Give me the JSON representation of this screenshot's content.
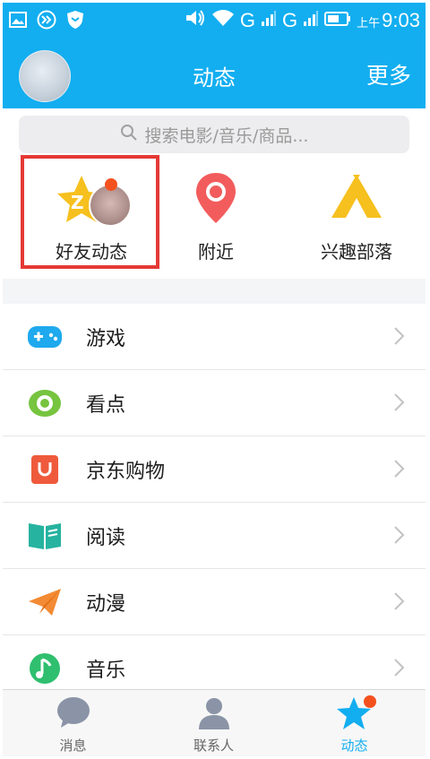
{
  "status_bar": {
    "network_1": "G",
    "network_2": "G",
    "ampm": "上午",
    "time": "9:03"
  },
  "header": {
    "title": "动态",
    "more_label": "更多"
  },
  "search": {
    "placeholder": "搜索电影/音乐/商品..."
  },
  "quick_actions": [
    {
      "label": "好友动态",
      "icon": "friend-feed-star-icon",
      "has_badge": true
    },
    {
      "label": "附近",
      "icon": "location-pin-icon"
    },
    {
      "label": "兴趣部落",
      "icon": "tent-icon"
    }
  ],
  "list_items": [
    {
      "label": "游戏",
      "icon": "gamepad-icon"
    },
    {
      "label": "看点",
      "icon": "eye-icon"
    },
    {
      "label": "京东购物",
      "icon": "shopping-bag-icon"
    },
    {
      "label": "阅读",
      "icon": "book-icon"
    },
    {
      "label": "动漫",
      "icon": "paper-plane-icon"
    },
    {
      "label": "音乐",
      "icon": "music-note-icon"
    }
  ],
  "tabs": [
    {
      "label": "消息",
      "icon": "chat-bubble-icon"
    },
    {
      "label": "联系人",
      "icon": "contacts-icon"
    },
    {
      "label": "动态",
      "icon": "star-icon",
      "active": true
    }
  ],
  "colors": {
    "brand": "#12aef0",
    "highlight": "#e53935",
    "badge": "#f4511e"
  }
}
